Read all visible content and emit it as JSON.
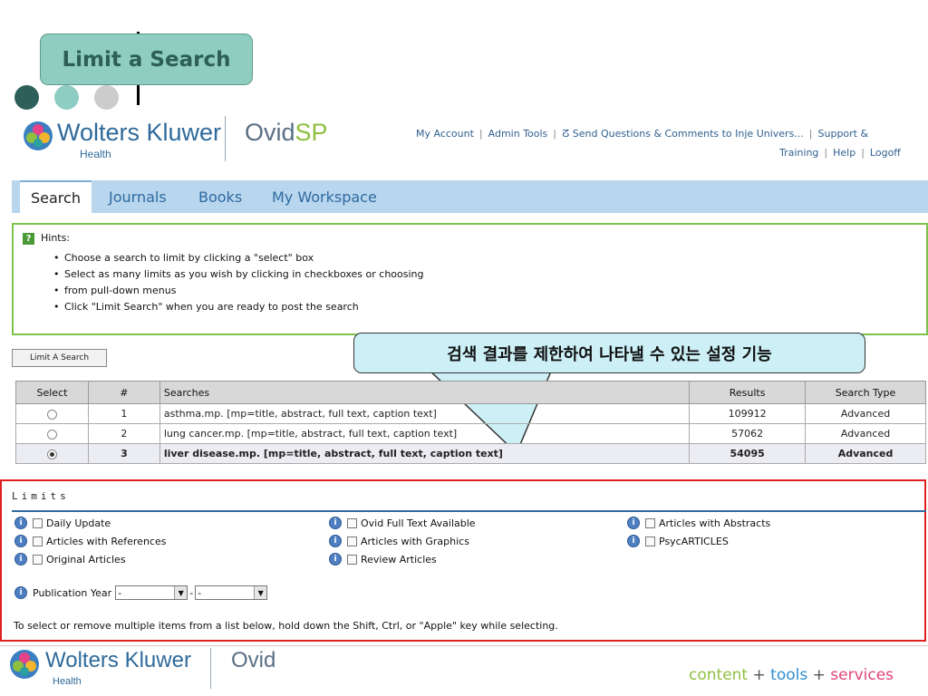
{
  "slide": {
    "title": "Limit a Search",
    "dot_colors": [
      "#2f5f5a",
      "#8ecdc4",
      "#cccccc"
    ]
  },
  "header": {
    "brand": "Wolters Kluwer",
    "brand_sub": "Health",
    "product_prefix": "Ovid",
    "product_suffix": "SP",
    "links_row1": [
      "My Account",
      "Admin Tools",
      "Send Questions & Comments to Inje Univers...",
      "Support &"
    ],
    "links_row2": [
      "Training",
      "Help",
      "Logoff"
    ]
  },
  "tabs": [
    "Search",
    "Journals",
    "Books",
    "My Workspace"
  ],
  "hints": {
    "heading": "Hints:",
    "items": [
      "Choose a search to limit by clicking a \"select\" box",
      "Select as many limits as you wish by clicking in checkboxes or choosing",
      "from pull-down menus",
      "Click \"Limit Search\" when you are ready to post the search"
    ]
  },
  "limit_button": "Limit A Search",
  "callout": "검색 결과를 제한하여 나타낼 수 있는 설정 기능",
  "table": {
    "headers": [
      "Select",
      "#",
      "Searches",
      "Results",
      "Search Type"
    ],
    "rows": [
      {
        "num": "1",
        "search": "asthma.mp. [mp=title, abstract, full text, caption text]",
        "results": "109912",
        "type": "Advanced",
        "selected": false
      },
      {
        "num": "2",
        "search": "lung cancer.mp. [mp=title, abstract, full text, caption text]",
        "results": "57062",
        "type": "Advanced",
        "selected": false
      },
      {
        "num": "3",
        "search": "liver disease.mp. [mp=title, abstract, full text, caption text]",
        "results": "54095",
        "type": "Advanced",
        "selected": true
      }
    ]
  },
  "limits": {
    "title": "Limits",
    "col1": [
      "Daily Update",
      "Articles with References",
      "Original Articles"
    ],
    "col2": [
      "Ovid Full Text Available",
      "Articles with Graphics",
      "Review Articles"
    ],
    "col3": [
      "Articles with Abstracts",
      "PsycARTICLES"
    ],
    "pub_year_label": "Publication Year",
    "pub_year_from": "-",
    "pub_year_to": "-",
    "note": "To select or remove multiple items from a list below, hold down the Shift, Ctrl, or \"Apple\" key while selecting."
  },
  "footer": {
    "brand": "Wolters Kluwer",
    "brand_sub": "Health",
    "product": "Ovid",
    "tag_content": "content",
    "tag_plus1": "+",
    "tag_tools": "tools",
    "tag_plus2": "+",
    "tag_services": "services",
    "colors": {
      "content": "#8fbf3f",
      "tools": "#2f8fd0",
      "services": "#e0457b",
      "plus": "#555555"
    }
  }
}
